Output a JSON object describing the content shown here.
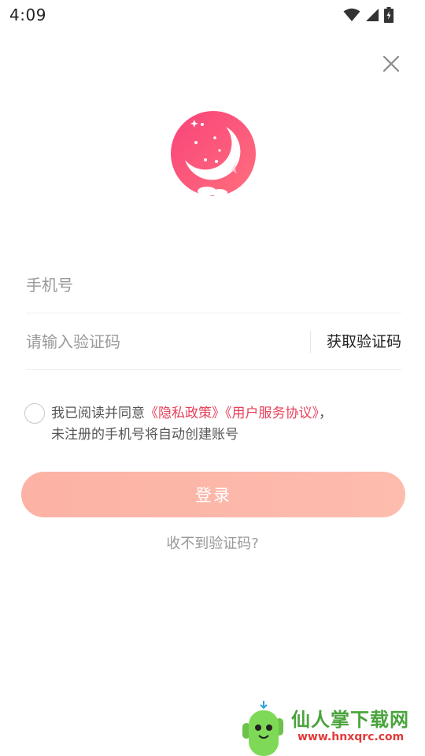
{
  "status_bar": {
    "time": "4:09",
    "icons": [
      "wifi-icon",
      "signal-icon",
      "battery-icon"
    ]
  },
  "login": {
    "phone_placeholder": "手机号",
    "code_placeholder": "请输入验证码",
    "get_code_label": "获取验证码",
    "agreement_prefix": "我已阅读并同意",
    "privacy_link": "《隐私政策》",
    "terms_link": "《用户服务协议》",
    "agreement_suffix": "，",
    "agreement_line2": "未注册的手机号将自动创建账号",
    "submit_label": "登录",
    "help_link": "收不到验证码?"
  },
  "watermark": {
    "text": "仙人掌下载网",
    "url": "www.hnxqrc.com"
  },
  "colors": {
    "accent_link": "#e8415b",
    "button_start": "#fcb2a4",
    "logo_start": "#f9437a",
    "logo_end": "#ff6f7d"
  }
}
